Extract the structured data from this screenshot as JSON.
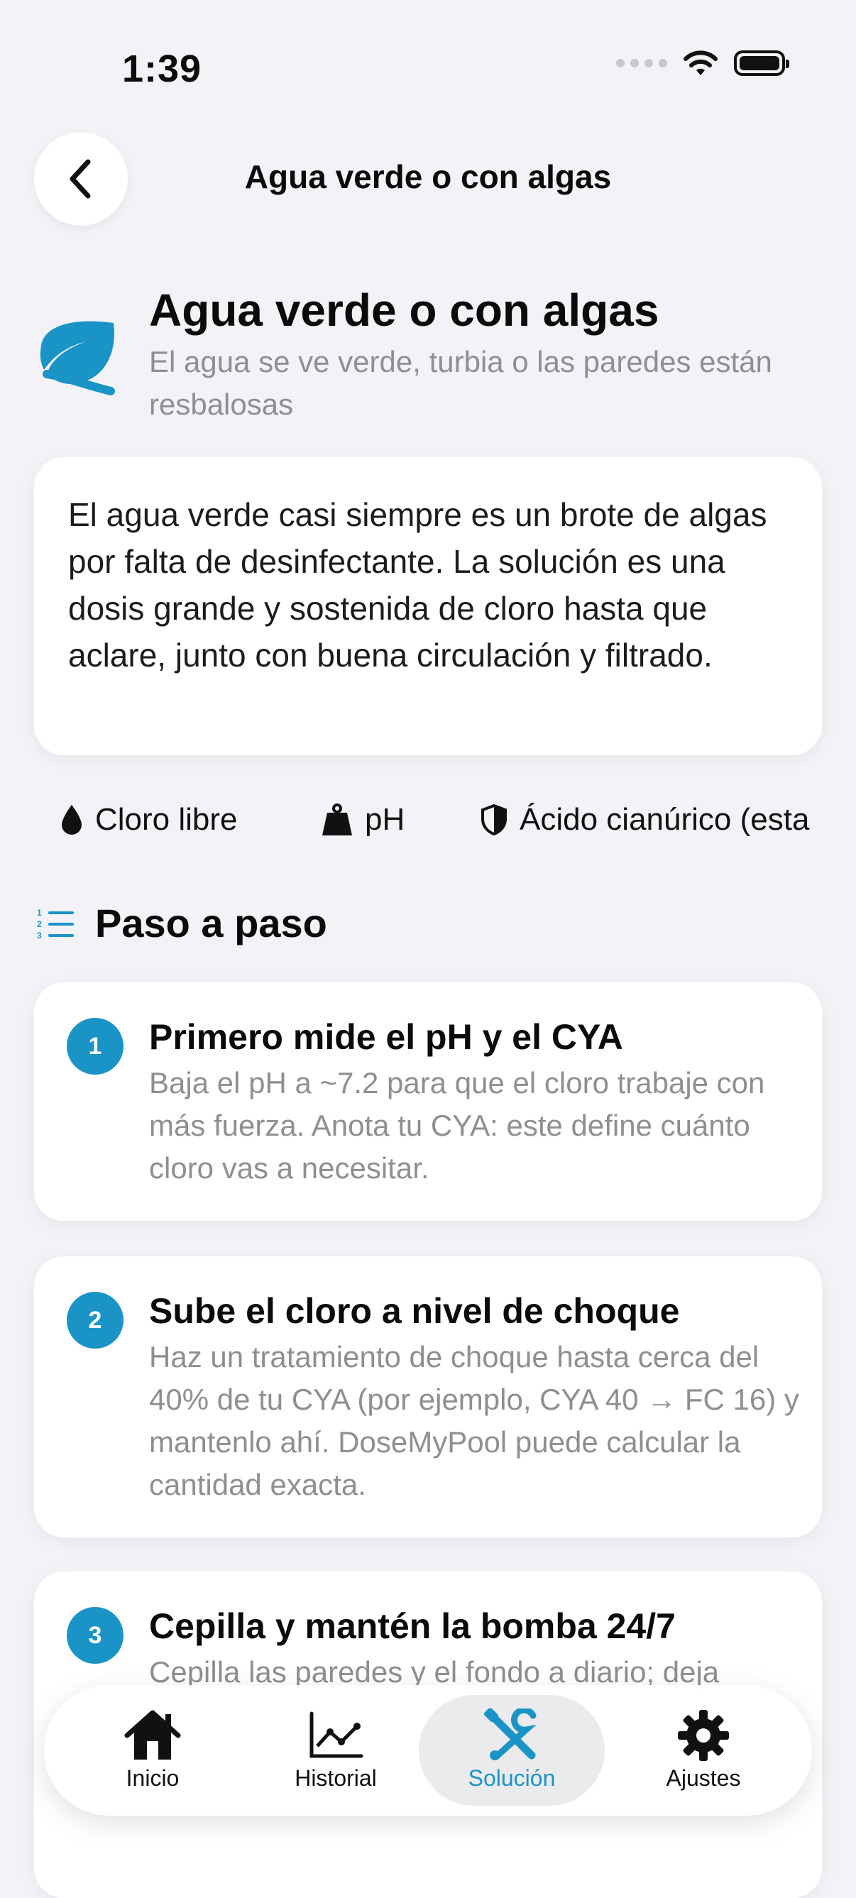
{
  "status_bar": {
    "time": "1:39"
  },
  "nav": {
    "title": "Agua verde o con algas",
    "back_icon": "chevron-left-icon"
  },
  "hero": {
    "icon": "leaf-icon",
    "title": "Agua verde o con algas",
    "subtitle": "El agua se ve verde, turbia o las paredes están resbalosas"
  },
  "intro": {
    "text": "El agua verde casi siempre es un brote de algas por falta de desinfectante. La solución es una dosis grande y sostenida de cloro hasta que aclare, junto con buena circulación y filtrado."
  },
  "parameters": [
    {
      "label": "Cloro libre",
      "icon": "drop-icon"
    },
    {
      "label": "pH",
      "icon": "scale-weight-icon"
    },
    {
      "label": "Ácido cianúrico (esta",
      "icon": "shield-icon"
    }
  ],
  "section": {
    "title": "Paso a paso",
    "icon": "numbered-list-icon"
  },
  "steps": [
    {
      "number": "1",
      "title": "Primero mide el pH y el CYA",
      "body": "Baja el pH a ~7.2 para que el cloro trabaje con más fuerza. Anota tu CYA: este define cuánto cloro vas a necesitar."
    },
    {
      "number": "2",
      "title": "Sube el cloro a nivel de choque",
      "body": "Haz un tratamiento de choque hasta cerca del 40% de tu CYA (por ejemplo, CYA 40 → FC 16) y mantenlo ahí. DoseMyPool puede calcular la cantidad exacta."
    },
    {
      "number": "3",
      "title": "Cepilla y mantén la bomba 24/7",
      "body": "Cepilla las paredes y el fondo a diario; deja"
    }
  ],
  "tabbar": {
    "tabs": [
      {
        "label": "Inicio",
        "icon": "house-icon"
      },
      {
        "label": "Historial",
        "icon": "chart-line-icon"
      },
      {
        "label": "Solución",
        "icon": "tools-icon"
      },
      {
        "label": "Ajustes",
        "icon": "gear-icon"
      }
    ],
    "active": "Solución"
  },
  "colors": {
    "accent": "#1a94c6",
    "background": "#f2f2f7",
    "secondary_text": "#8e8e93"
  }
}
